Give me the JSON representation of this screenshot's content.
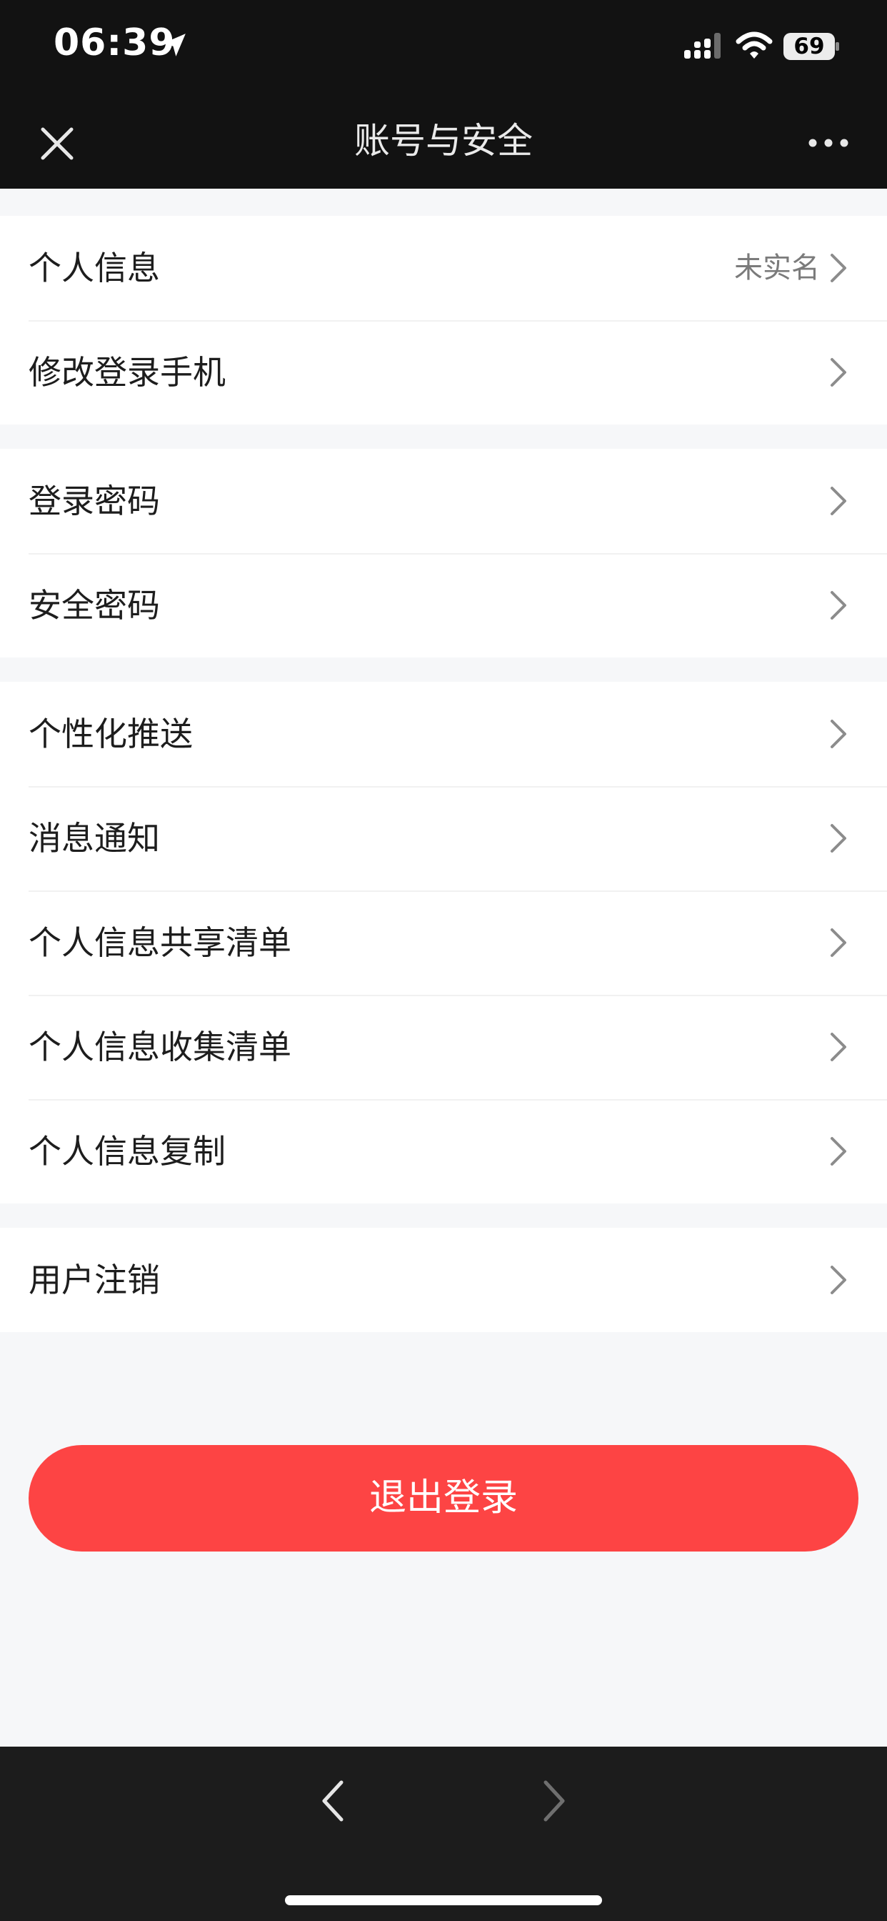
{
  "status_bar": {
    "time": "06:39",
    "battery": "69",
    "icons": [
      "location-arrow-icon",
      "cellular-signal-icon",
      "wifi-icon",
      "battery-icon"
    ]
  },
  "nav": {
    "title": "账号与安全",
    "close_icon": "close-icon",
    "more_icon": "more-icon"
  },
  "groups": [
    {
      "items": [
        {
          "label": "个人信息",
          "value": "未实名"
        },
        {
          "label": "修改登录手机",
          "value": ""
        }
      ]
    },
    {
      "items": [
        {
          "label": "登录密码",
          "value": ""
        },
        {
          "label": "安全密码",
          "value": ""
        }
      ]
    },
    {
      "items": [
        {
          "label": "个性化推送",
          "value": ""
        },
        {
          "label": "消息通知",
          "value": ""
        },
        {
          "label": "个人信息共享清单",
          "value": ""
        },
        {
          "label": "个人信息收集清单",
          "value": ""
        },
        {
          "label": "个人信息复制",
          "value": ""
        }
      ]
    },
    {
      "items": [
        {
          "label": "用户注销",
          "value": ""
        }
      ]
    }
  ],
  "logout_label": "退出登录",
  "bottom_bar": {
    "back_icon": "chevron-left-icon",
    "forward_icon": "chevron-right-icon"
  },
  "colors": {
    "accent": "#fd4444",
    "background": "#f6f7f9",
    "dark_bar": "#121212"
  }
}
